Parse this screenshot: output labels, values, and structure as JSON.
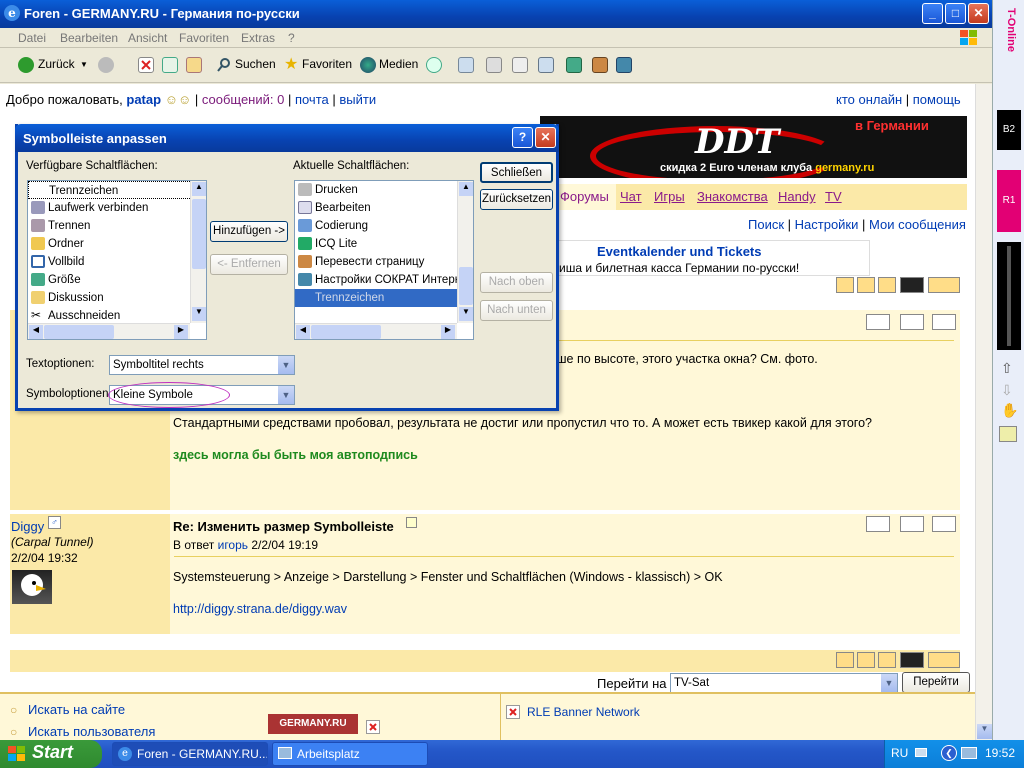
{
  "window": {
    "title": "Foren - GERMANY.RU - Германия по-русски",
    "buttons": {
      "minimize": "_",
      "maximize": "□",
      "close": "✕"
    }
  },
  "menubar": [
    "Datei",
    "Bearbeiten",
    "Ansicht",
    "Favoriten",
    "Extras",
    "?"
  ],
  "toolbar": {
    "back": "Zurück",
    "search": "Suchen",
    "favorites": "Favoriten",
    "media": "Medien"
  },
  "forum": {
    "welcome": "Добро пожаловать,",
    "user": "patap",
    "messages": "сообщений: 0",
    "mail": "почта",
    "logout": "выйти",
    "who_online": "кто онлайн",
    "help": "помощь",
    "banner_top": "в Германии",
    "banner_logo": "DDT",
    "banner_discount": "скидка 2 Euro членам клуба",
    "banner_site": "germany.ru",
    "nav": [
      "Форумы",
      "Чат",
      "Игры",
      "Знакомства",
      "Handy",
      "TV"
    ],
    "subnav": [
      "Поиск",
      "Настройки",
      "Мои сообщения"
    ],
    "event_title": "Eventkalender und Tickets",
    "event_sub": "Афиша и билетная касса Германии по-русски!",
    "post1": {
      "text_partial": "ьше по высоте, этого участка окна? См. фото.",
      "text2": "Стандартными средствами пробовал, результата не достиг или пропустил что то. А может есть твикер какой для этого?",
      "signature": "здесь могла бы быть моя автоподпись"
    },
    "post2": {
      "author": "Diggy",
      "rank": "(Carpal Tunnel)",
      "date": "2/2/04 19:32",
      "title": "Re: Изменить размер Symbolleiste",
      "reply_prefix": "В ответ",
      "reply_user": "игорь",
      "reply_date": "2/2/04 19:19",
      "body": "Systemsteuerung > Anzeige > Darstellung > Fenster und Schaltflächen (Windows - klassisch) > OK",
      "link": "http://diggy.strana.de/diggy.wav"
    },
    "goto_label": "Перейти на",
    "goto_value": "TV-Sat",
    "goto_button": "Перейти"
  },
  "bottom": {
    "search_site": "Искать на сайте",
    "search_user": "Искать пользователя",
    "banner_logo": "GERMANY.RU",
    "banner_network": "RLE Banner Network"
  },
  "dialog": {
    "title": "Symbolleiste anpassen",
    "help": "?",
    "available_label": "Verfügbare Schaltflächen:",
    "current_label": "Aktuelle Schaltflächen:",
    "available": [
      {
        "label": "Trennzeichen",
        "icon": "separator-icon"
      },
      {
        "label": "Laufwerk verbinden",
        "icon": "map-drive-icon"
      },
      {
        "label": "Trennen",
        "icon": "disconnect-icon"
      },
      {
        "label": "Ordner",
        "icon": "folder-icon"
      },
      {
        "label": "Vollbild",
        "icon": "fullscreen-icon"
      },
      {
        "label": "Größe",
        "icon": "size-icon"
      },
      {
        "label": "Diskussion",
        "icon": "discussion-icon"
      },
      {
        "label": "Ausschneiden",
        "icon": "scissors-icon"
      }
    ],
    "current": [
      {
        "label": "Drucken",
        "icon": "printer-icon"
      },
      {
        "label": "Bearbeiten",
        "icon": "edit-icon"
      },
      {
        "label": "Codierung",
        "icon": "encoding-icon"
      },
      {
        "label": "ICQ Lite",
        "icon": "icq-icon"
      },
      {
        "label": "Перевести страницу",
        "icon": "translate-icon"
      },
      {
        "label": "Настройки СОКРАТ Интерн",
        "icon": "socrat-icon"
      },
      {
        "label": "Trennzeichen",
        "icon": "separator-icon"
      }
    ],
    "buttons": {
      "close": "Schließen",
      "reset": "Zurücksetzen",
      "add": "Hinzufügen ->",
      "remove": "<- Entfernen",
      "up": "Nach oben",
      "down": "Nach unten"
    },
    "text_options_label": "Textoptionen:",
    "text_options_value": "Symboltitel rechts",
    "icon_options_label": "Symboloptionen:",
    "icon_options_value": "Kleine Symbole"
  },
  "taskbar": {
    "start": "Start",
    "tasks": [
      "Foren - GERMANY.RU...",
      "Arbeitsplatz"
    ],
    "lang": "RU",
    "clock": "19:52"
  },
  "sidebar": {
    "brand": "T-Online",
    "b2": "B2",
    "r1": "R1"
  }
}
